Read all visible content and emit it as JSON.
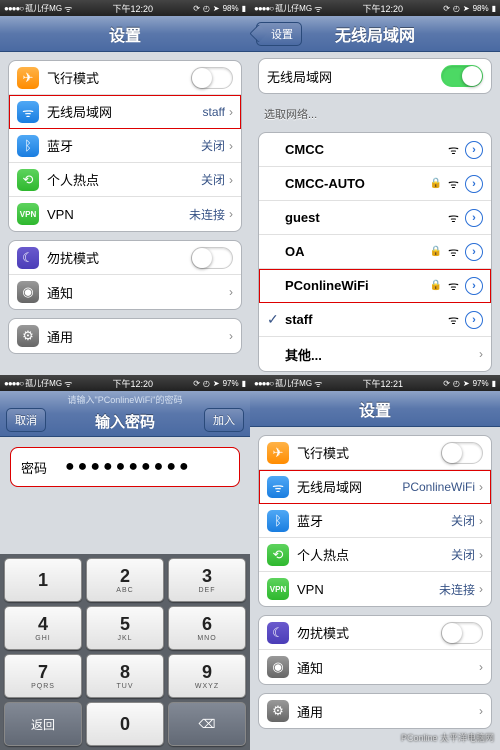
{
  "sb1": {
    "carrier": "孤儿仔MG",
    "time": "下午12:20",
    "batt": "98%"
  },
  "sb2": {
    "carrier": "孤儿仔MG",
    "time": "下午12:20",
    "batt": "98%"
  },
  "sb3": {
    "carrier": "孤儿仔MG",
    "time": "下午12:20",
    "batt": "97%"
  },
  "sb4": {
    "carrier": "孤儿仔MG",
    "time": "下午12:21",
    "batt": "97%"
  },
  "p1": {
    "title": "设置",
    "rows": {
      "airplane": "飞行模式",
      "wifi": "无线局域网",
      "wifi_val": "staff",
      "bt": "蓝牙",
      "bt_val": "关闭",
      "hot": "个人热点",
      "hot_val": "关闭",
      "vpn": "VPN",
      "vpn_val": "未连接",
      "dnd": "勿扰模式",
      "notif": "通知",
      "gen": "通用"
    }
  },
  "p2": {
    "back": "设置",
    "title": "无线局域网",
    "wifi_label": "无线局域网",
    "choose": "选取网络...",
    "nets": [
      {
        "name": "CMCC",
        "lock": false
      },
      {
        "name": "CMCC-AUTO",
        "lock": true
      },
      {
        "name": "guest",
        "lock": false
      },
      {
        "name": "OA",
        "lock": true
      },
      {
        "name": "PConlineWiFi",
        "lock": true,
        "hl": true
      },
      {
        "name": "staff",
        "lock": false,
        "check": true
      }
    ],
    "other": "其他..."
  },
  "p3": {
    "prompt": "请输入\"PConlineWiFi\"的密码",
    "cancel": "取消",
    "title": "输入密码",
    "join": "加入",
    "pw_label": "密码",
    "pw_value": "●●●●●●●●●●",
    "keys": [
      {
        "n": "1",
        "l": ""
      },
      {
        "n": "2",
        "l": "ABC"
      },
      {
        "n": "3",
        "l": "DEF"
      },
      {
        "n": "4",
        "l": "GHI"
      },
      {
        "n": "5",
        "l": "JKL"
      },
      {
        "n": "6",
        "l": "MNO"
      },
      {
        "n": "7",
        "l": "PQRS"
      },
      {
        "n": "8",
        "l": "TUV"
      },
      {
        "n": "9",
        "l": "WXYZ"
      }
    ],
    "ret": "返回",
    "zero": "0",
    "del": "⌫"
  },
  "p4": {
    "title": "设置",
    "rows": {
      "airplane": "飞行模式",
      "wifi": "无线局域网",
      "wifi_val": "PConlineWiFi",
      "bt": "蓝牙",
      "bt_val": "关闭",
      "hot": "个人热点",
      "hot_val": "关闭",
      "vpn": "VPN",
      "vpn_val": "未连接",
      "dnd": "勿扰模式",
      "notif": "通知",
      "gen": "通用"
    },
    "watermark": "PConline\n太平洋电脑网"
  }
}
